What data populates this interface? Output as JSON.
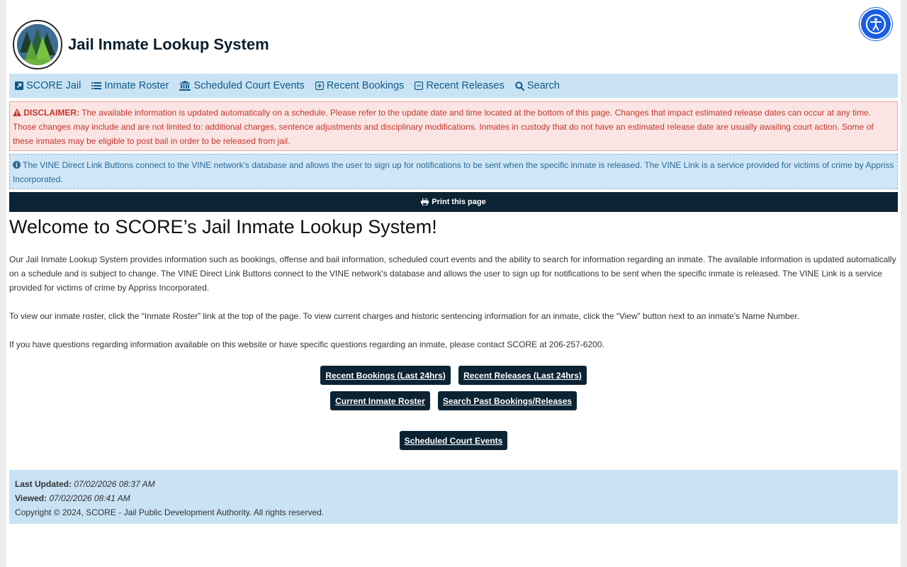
{
  "header": {
    "title": "Jail Inmate Lookup System"
  },
  "nav": {
    "items": [
      {
        "label": "SCORE Jail",
        "icon": "external-link-icon"
      },
      {
        "label": "Inmate Roster",
        "icon": "list-icon"
      },
      {
        "label": "Scheduled Court Events",
        "icon": "courthouse-icon"
      },
      {
        "label": "Recent Bookings",
        "icon": "plus-square-icon"
      },
      {
        "label": "Recent Releases",
        "icon": "minus-square-icon"
      },
      {
        "label": "Search",
        "icon": "search-icon"
      }
    ]
  },
  "disclaimer": {
    "label": "DISCLAIMER:",
    "text": "The available information is updated automatically on a schedule. Please refer to the update date and time located at the bottom of this page. Changes that impact estimated release dates can occur at any time. Those changes may include and are not limited to: additional charges, sentence adjustments and disciplinary modifications. Inmates in custody that do not have an estimated release date are usually awaiting court action. Some of these inmates may be eligible to post bail in order to be released from jail."
  },
  "vine_notice": {
    "text": "The VINE Direct Link Buttons connect to the VINE network's database and allows the user to sign up for notifications to be sent when the specific inmate is released. The VINE Link is a service provided for victims of crime by Appriss Incorporated."
  },
  "print_label": "Print this page",
  "main": {
    "heading": "Welcome to SCORE’s Jail Inmate Lookup System!",
    "paragraph1": "Our Jail Inmate Lookup System provides information such as bookings, offense and bail information, scheduled court events and the ability to search for information regarding an inmate. The available information is updated automatically on a schedule and is subject to change. The VINE Direct Link Buttons connect to the VINE network's database and allows the user to sign up for notifications to be sent when the specific inmate is released. The VINE Link is a service provided for victims of crime by Appriss Incorporated.",
    "paragraph2": "To view our inmate roster, click the “Inmate Roster” link at the top of the page. To view current charges and historic sentencing information for an inmate, click the “View” button next to an inmate's Name Number.",
    "paragraph3": "If you have questions regarding information available on this website or have specific questions regarding an inmate, please contact SCORE at 206-257-6200.",
    "buttons": {
      "recent_bookings": "Recent Bookings (Last 24hrs)",
      "recent_releases": "Recent Releases (Last 24hrs)",
      "current_roster": "Current Inmate Roster",
      "search_past": "Search Past Bookings/Releases",
      "court_events": "Scheduled Court Events"
    }
  },
  "footer": {
    "last_updated_label": "Last Updated:",
    "last_updated_value": "07/02/2026 08:37 AM",
    "viewed_label": "Viewed:",
    "viewed_value": "07/02/2026 08:41 AM",
    "copyright": "Copyright © 2024, SCORE - Jail Public Development Authority. All rights reserved."
  },
  "colors": {
    "nav_bg": "#c9e3f5",
    "dark_navy": "#0b2333",
    "disclaimer_text": "#c0392b",
    "link_blue": "#125a8a",
    "a11y_blue": "#1a5fe0"
  }
}
